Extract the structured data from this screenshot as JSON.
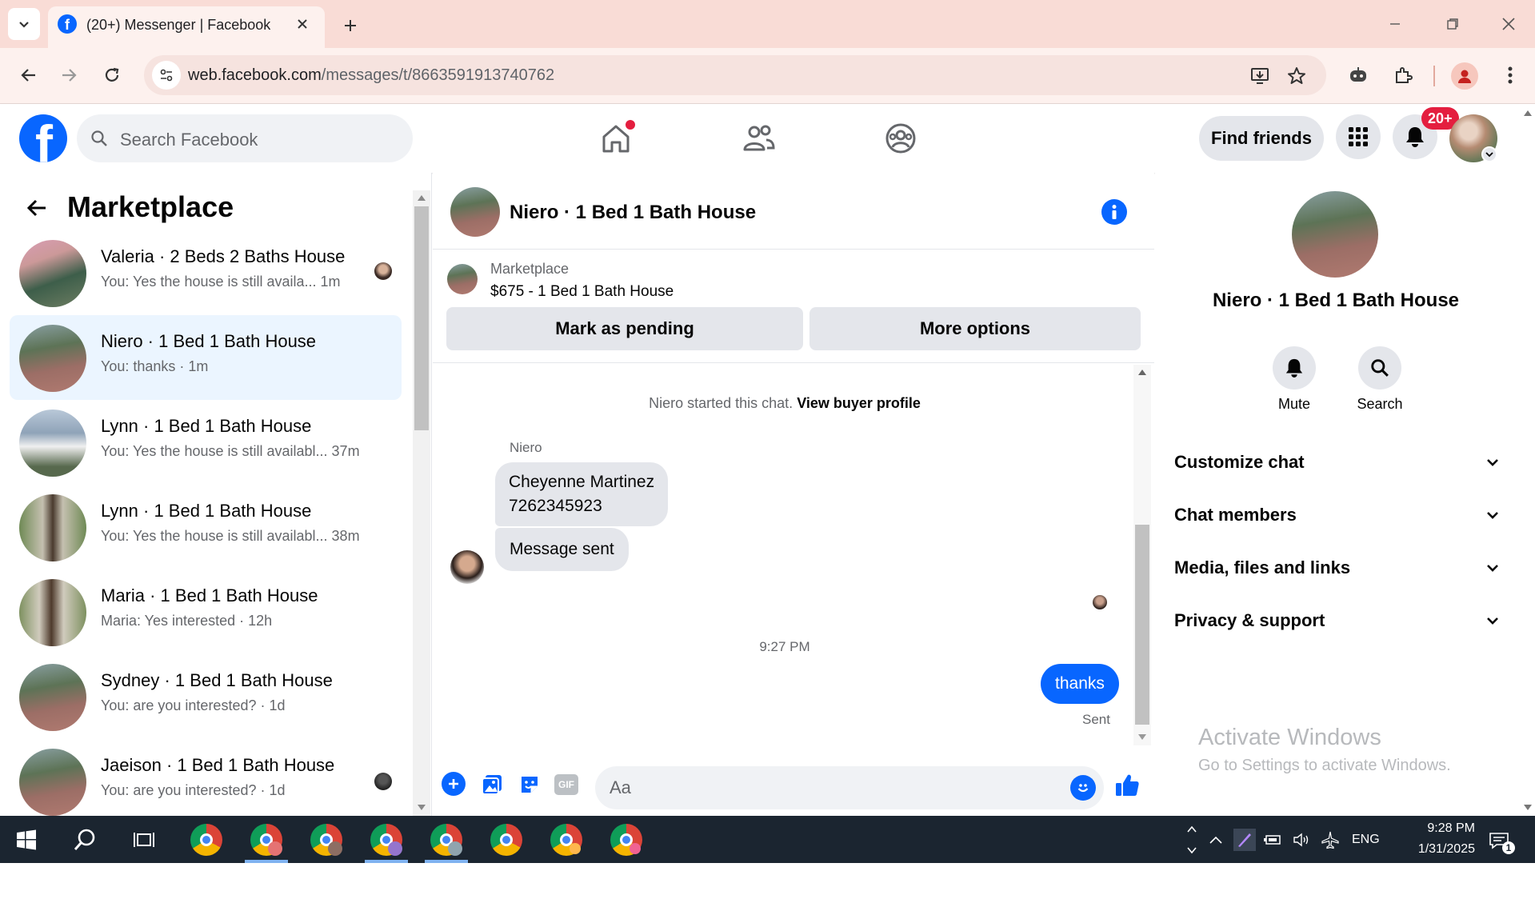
{
  "browser": {
    "tab_title": "(20+) Messenger | Facebook",
    "url_host": "web.facebook.com",
    "url_path": "/messages/t/8663591913740762",
    "icons": [
      "tab-list-icon",
      "facebook-favicon",
      "close-tab-icon",
      "new-tab-icon",
      "minimize-icon",
      "restore-icon",
      "close-window-icon",
      "back-icon",
      "forward-icon",
      "reload-icon",
      "site-info-icon",
      "install-app-icon",
      "bookmark-star-icon",
      "copilot-icon",
      "extensions-icon",
      "profile-icon",
      "menu-icon"
    ]
  },
  "fb_header": {
    "search_placeholder": "Search Facebook",
    "find_friends_label": "Find friends",
    "notification_badge": "20+",
    "accent": "#0866ff",
    "badge_color": "#e41e3f"
  },
  "left_pane": {
    "title": "Marketplace",
    "conversations": [
      {
        "name": "Valeria · 2 Beds 2 Baths House",
        "preview": "You: Yes the house is still availa...",
        "time": "1m",
        "active": false
      },
      {
        "name": "Niero · 1 Bed 1 Bath House",
        "preview": "You: thanks",
        "time": "1m",
        "active": true
      },
      {
        "name": "Lynn · 1 Bed 1 Bath House",
        "preview": "You: Yes the house is still availabl...",
        "time": "37m",
        "active": false
      },
      {
        "name": "Lynn · 1 Bed 1 Bath House",
        "preview": "You: Yes the house is still availabl...",
        "time": "38m",
        "active": false
      },
      {
        "name": "Maria · 1 Bed 1 Bath House",
        "preview": "Maria: Yes interested",
        "time": "12h",
        "active": false
      },
      {
        "name": "Sydney · 1 Bed 1 Bath House",
        "preview": "You: are you interested?",
        "time": "1d",
        "active": false
      },
      {
        "name": "Jaeison · 1 Bed 1 Bath House",
        "preview": "You: are you interested?",
        "time": "1d",
        "active": false
      }
    ]
  },
  "chat": {
    "title": "Niero · 1 Bed 1 Bath House",
    "listing_label": "Marketplace",
    "listing_price_title": "$675 - 1 Bed 1 Bath House",
    "mark_pending_label": "Mark as pending",
    "more_options_label": "More options",
    "started_text": "Niero started this chat.",
    "view_buyer_profile": "View buyer profile",
    "sender_name": "Niero",
    "msg1_line1": "Cheyenne Martinez",
    "msg1_line2": "7262345923",
    "msg2": "Message sent",
    "timestamp": "9:27 PM",
    "my_msg": "thanks",
    "status": "Sent",
    "composer_placeholder": "Aa"
  },
  "details": {
    "title": "Niero · 1 Bed 1 Bath House",
    "mute_label": "Mute",
    "search_label": "Search",
    "sections": [
      "Customize chat",
      "Chat members",
      "Media, files and links",
      "Privacy & support"
    ],
    "watermark_title": "Activate Windows",
    "watermark_sub": "Go to Settings to activate Windows."
  },
  "taskbar": {
    "time": "9:28 PM",
    "date": "1/31/2025",
    "lang": "ENG",
    "notif_count": "1"
  }
}
